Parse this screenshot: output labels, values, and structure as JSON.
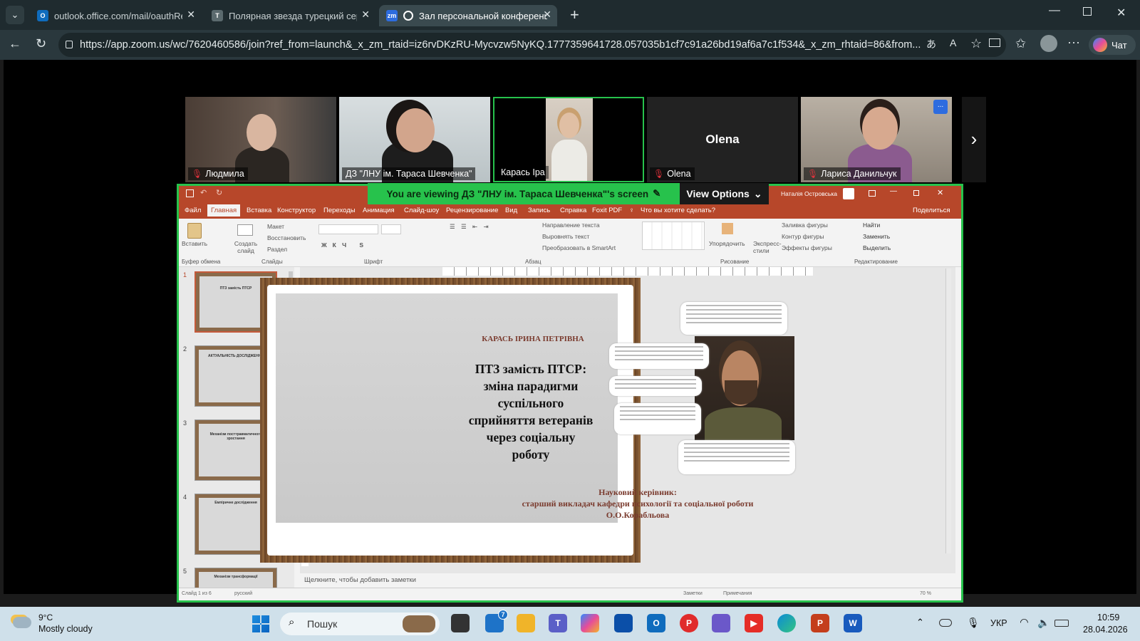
{
  "browser": {
    "tabs": [
      {
        "title": "outlook.office.com/mail/oauthRed",
        "icon": "outlook-icon"
      },
      {
        "title": "Полярная звезда турецкий сериа",
        "icon": "tv-icon"
      },
      {
        "title": "Зал персональной конференции",
        "icon": "zoom-icon"
      }
    ],
    "url": "https://app.zoom.us/wc/7620460586/join?ref_from=launch&_x_zm_rtaid=iz6rvDKzRU-Mycvzw5NyKQ.1777359641728.057035b1cf7c91a26bd19af6a7c1f534&_x_zm_rhtaid=86&from...",
    "copilot_label": "Чат"
  },
  "zoom": {
    "participants": [
      {
        "name": "Людмила",
        "muted": true
      },
      {
        "name": "ДЗ \"ЛНУ ім. Тараса Шевченка\"",
        "muted": false
      },
      {
        "name": "Карась Іра",
        "muted": false
      },
      {
        "name": "Olena",
        "muted": true,
        "display_name": "Olena"
      },
      {
        "name": "Лариса Данильчук",
        "muted": true
      }
    ],
    "more_label": "...",
    "banner": "You are viewing  ДЗ \"ЛНУ ім. Тараса Шевченка\"'s screen",
    "view_options": "View Options"
  },
  "ppt": {
    "user": "Наталія Островська",
    "menu": [
      "Файл",
      "Главная",
      "Вставка",
      "Конструктор",
      "Переходы",
      "Анимация",
      "Слайд-шоу",
      "Рецензирование",
      "Вид",
      "Запись",
      "Справка",
      "Foxit PDF",
      "Что вы хотите сделать?"
    ],
    "share": "Поделиться",
    "ribbon": {
      "paste": "Вставить",
      "new_slide": "Создать слайд",
      "layout": "Макет",
      "reset": "Восстановить",
      "section": "Раздел",
      "text_dir": "Направление текста",
      "align_text": "Выровнять текст",
      "smartart": "Преобразовать в SmartArt",
      "arrange": "Упорядочить",
      "quick_styles": "Экспресс-стили",
      "shape_fill": "Заливка фигуры",
      "shape_outline": "Контур фигуры",
      "shape_effects": "Эффекты фигуры",
      "find": "Найти",
      "replace": "Заменить",
      "select": "Выделить",
      "groups": [
        "Буфер обмена",
        "Слайды",
        "Шрифт",
        "Абзац",
        "Рисование",
        "Редактирование"
      ]
    },
    "slides": [
      {
        "num": "1",
        "text": "ПТЗ замість ПТСР"
      },
      {
        "num": "2",
        "text": "АКТУАЛЬНІСТЬ ДОСЛІДЖЕННЯ"
      },
      {
        "num": "3",
        "text": "Механізм посттравматичного зростання"
      },
      {
        "num": "4",
        "text": "Емпіричне дослідження"
      },
      {
        "num": "5",
        "text": "Механізм трансформації"
      }
    ],
    "slide": {
      "author": "КАРАСЬ ІРИНА ПЕТРІВНА",
      "title": "ПТЗ замість ПТСР: зміна парадигми суспільного сприйняття ветеранів через соціальну роботу",
      "supervisor_label": "Науковий керівник:",
      "supervisor_line": "старший викладач кафедри психології та соціальної роботи",
      "supervisor_name": "О.О.Корабльова"
    },
    "notes_placeholder": "Щелкните, чтобы добавить заметки",
    "status_left": "Слайд 1 из 6",
    "status_lang": "русский",
    "status_notes": "Заметки",
    "status_comments": "Примечания",
    "zoom_level": "70 %"
  },
  "taskbar": {
    "weather_temp": "9°C",
    "weather_text": "Mostly cloudy",
    "search": "Пошук",
    "store_badge": "7",
    "lang": "УКР",
    "time": "10:59",
    "date": "28.04.2026"
  },
  "colors": {
    "zoom_green": "#27c24c",
    "ppt_red": "#b7472a",
    "muted_red": "#e0323b"
  }
}
